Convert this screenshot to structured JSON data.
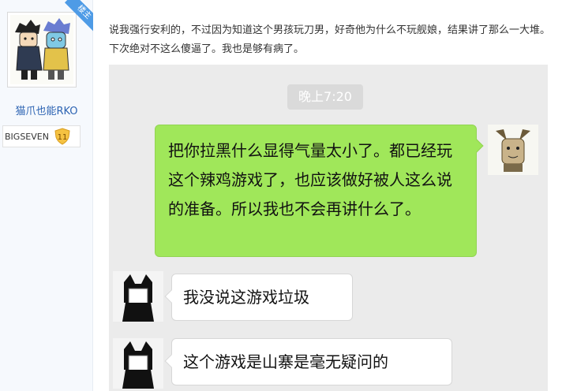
{
  "sidebar": {
    "badge_label": "楼主",
    "username": "猫爪也能RKO",
    "level_name": "BIGSEVEN",
    "level_number": "11"
  },
  "post": {
    "text": "说我强行安利的，不过因为知道这个男孩玩刀男，好奇他为什么不玩舰娘，结果讲了那么一大堆。下次绝对不这么傻逼了。我也是够有病了。"
  },
  "chat": {
    "time": "晚上7:20",
    "messages": [
      {
        "side": "right",
        "text": "把你拉黑什么显得气量太小了。都已经玩这个辣鸡游戏了，也应该做好被人这么说的准备。所以我也不会再讲什么了。"
      },
      {
        "side": "left",
        "text": "我没说这游戏垃圾"
      },
      {
        "side": "left",
        "text": "这个游戏是山寨是毫无疑问的"
      }
    ]
  },
  "colors": {
    "link_blue": "#2d64b3",
    "badge_blue": "#4e9be6",
    "bubble_green": "#a0e75a",
    "chat_bg": "#ebebeb"
  }
}
